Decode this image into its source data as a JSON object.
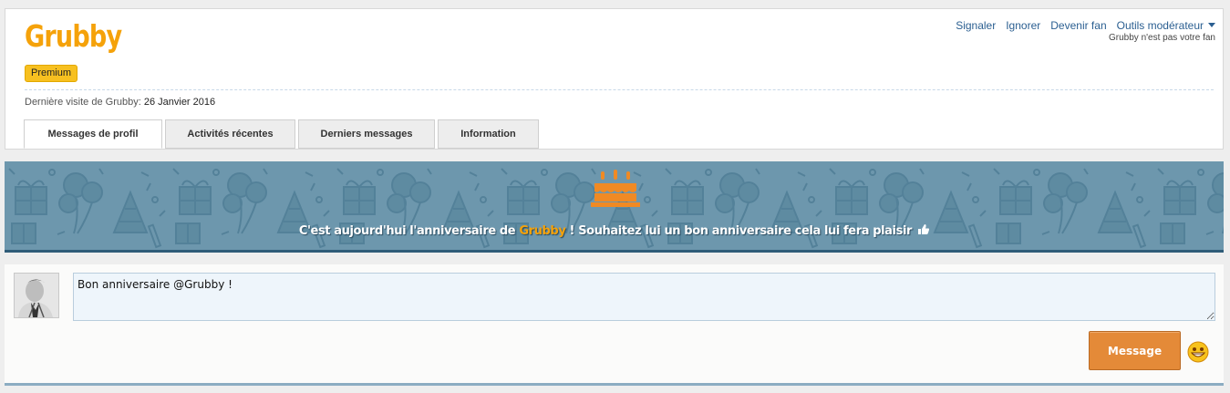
{
  "profile": {
    "username": "Grubby",
    "badge": "Premium",
    "last_visit_label": "Dernière visite de Grubby:",
    "last_visit_date": "26 Janvier 2016",
    "not_fan_text": "Grubby n'est pas votre fan"
  },
  "actions": {
    "report": "Signaler",
    "ignore": "Ignorer",
    "become_fan": "Devenir fan",
    "moderator_tools": "Outils modérateur"
  },
  "tabs": [
    {
      "label": "Messages de profil",
      "active": true
    },
    {
      "label": "Activités récentes",
      "active": false
    },
    {
      "label": "Derniers messages",
      "active": false
    },
    {
      "label": "Information",
      "active": false
    }
  ],
  "banner": {
    "text_before": "C'est aujourd'hui l'anniversaire de",
    "highlight_name": "Grubby",
    "text_after": "! Souhaitez lui un bon anniversaire cela lui fera plaisir",
    "icon": "cake-icon"
  },
  "comment": {
    "input_value": "Bon anniversaire @Grubby !",
    "submit_label": "Message",
    "smiley_icon": "smiley-icon"
  },
  "colors": {
    "brand": "#f5a20a",
    "link": "#2b5f91",
    "banner_bg": "#6d97ad",
    "button": "#e48a38"
  }
}
